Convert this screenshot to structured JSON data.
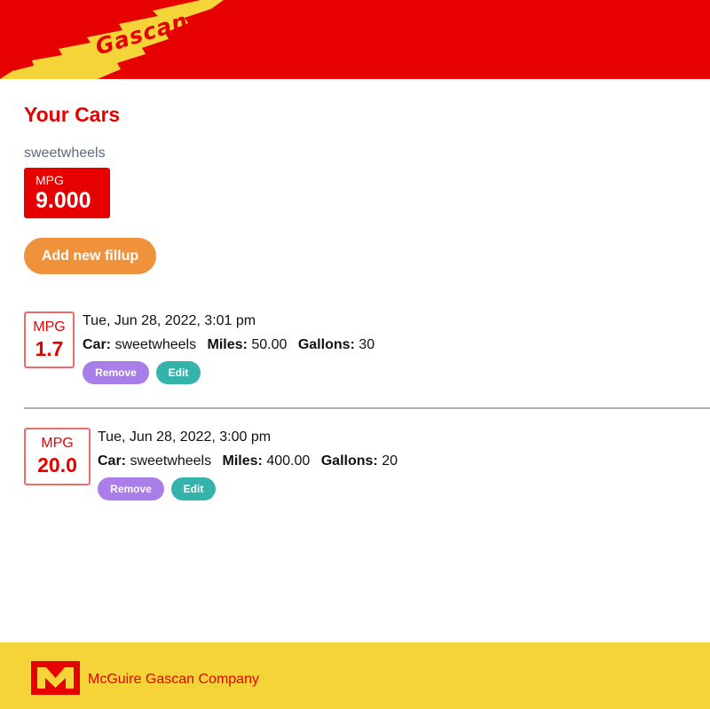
{
  "header": {
    "logo_text": "Gascan"
  },
  "main": {
    "title": "Your Cars",
    "car": {
      "name": "sweetwheels",
      "mpg_label": "MPG",
      "mpg_value": "9.000"
    },
    "add_button_label": "Add new fillup"
  },
  "fillups": [
    {
      "mpg_label": "MPG",
      "mpg_value": "1.7",
      "date": "Tue, Jun 28, 2022, 3:01 pm",
      "car_label": "Car:",
      "car_value": "sweetwheels",
      "miles_label": "Miles:",
      "miles_value": "50.00",
      "gallons_label": "Gallons:",
      "gallons_value": "30",
      "remove_label": "Remove",
      "edit_label": "Edit"
    },
    {
      "mpg_label": "MPG",
      "mpg_value": "20.0",
      "date": "Tue, Jun 28, 2022, 3:00 pm",
      "car_label": "Car:",
      "car_value": "sweetwheels",
      "miles_label": "Miles:",
      "miles_value": "400.00",
      "gallons_label": "Gallons:",
      "gallons_value": "20",
      "remove_label": "Remove",
      "edit_label": "Edit"
    }
  ],
  "footer": {
    "logo_letter": "M",
    "company_name": "McGuire Gascan Company"
  },
  "colors": {
    "brand_red": "#e60000",
    "brand_yellow": "#f5d43a",
    "add_button": "#f0913c",
    "remove_button": "#a97ee8",
    "edit_button": "#34b3ab"
  },
  "icons": {
    "header_lightning": "lightning-bolt-icon",
    "footer_logo": "m-logo-icon"
  }
}
